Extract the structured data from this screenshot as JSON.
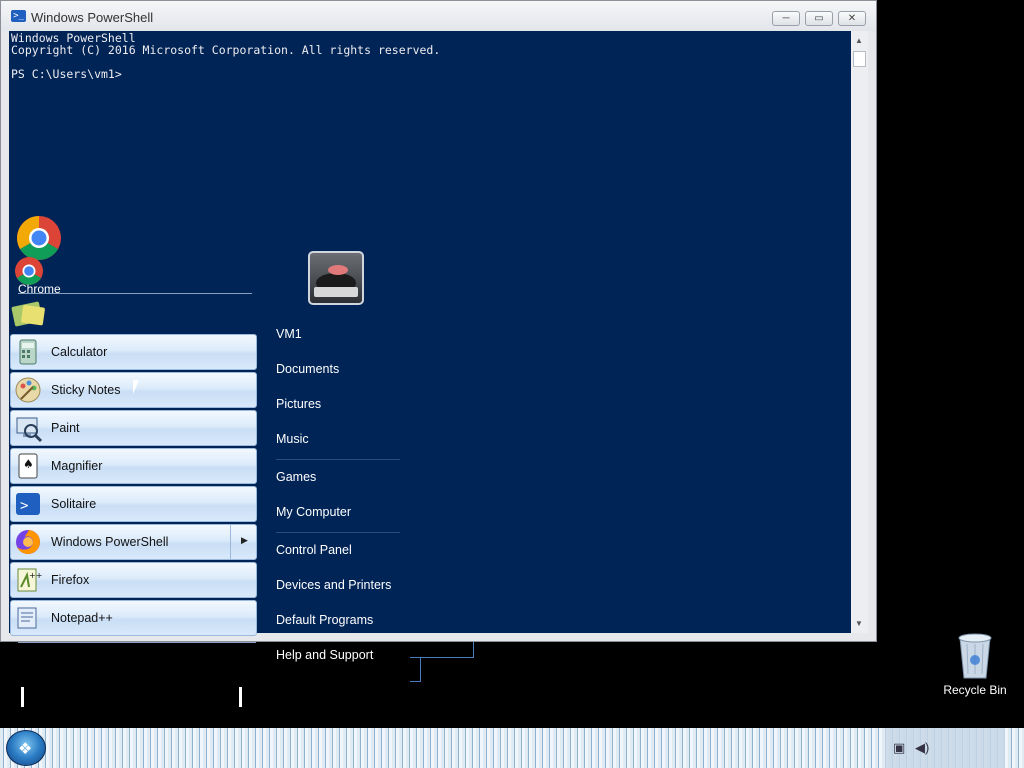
{
  "window": {
    "title": "Windows PowerShell",
    "controls": {
      "minimize": "─",
      "maximize": "▭",
      "close": "✕"
    },
    "console_lines": [
      "Windows PowerShell",
      "Copyright (C) 2016 Microsoft Corporation. All rights reserved.",
      "",
      "PS C:\\Users\\vm1>"
    ]
  },
  "start_menu": {
    "pinned": {
      "chrome_label": "Chrome"
    },
    "programs": [
      {
        "label": "Calculator",
        "icon": "calculator-icon"
      },
      {
        "label": "Sticky Notes",
        "icon": "sticky-notes-icon"
      },
      {
        "label": "Paint",
        "icon": "paint-icon"
      },
      {
        "label": "Magnifier",
        "icon": "magnifier-icon"
      },
      {
        "label": "Solitaire",
        "icon": "solitaire-icon"
      },
      {
        "label": "Windows PowerShell",
        "icon": "powershell-icon",
        "submenu": true
      },
      {
        "label": "Firefox",
        "icon": "firefox-icon"
      },
      {
        "label": "Notepad++",
        "icon": "notepad-plus-plus-icon"
      }
    ],
    "submenu_arrow": "▶",
    "right_links": [
      {
        "label": "VM1",
        "sep_after": false
      },
      {
        "label": "Documents",
        "sep_after": false
      },
      {
        "label": "Pictures",
        "sep_after": false
      },
      {
        "label": "Music",
        "sep_after": true
      },
      {
        "label": "Games",
        "sep_after": false
      },
      {
        "label": "My Computer",
        "sep_after": true
      },
      {
        "label": "Control Panel",
        "sep_after": false
      },
      {
        "label": "Devices and Printers",
        "sep_after": false
      },
      {
        "label": "Default Programs",
        "sep_after": false
      },
      {
        "label": "Help and Support",
        "sep_after": false
      }
    ]
  },
  "desktop": {
    "recycle_bin_label": "Recycle Bin"
  },
  "taskbar": {
    "start_glyph": "❖",
    "tray_icons": [
      "network-icon",
      "volume-icon"
    ]
  },
  "colors": {
    "console_bg": "#012456",
    "console_fg": "#eeedf0"
  }
}
